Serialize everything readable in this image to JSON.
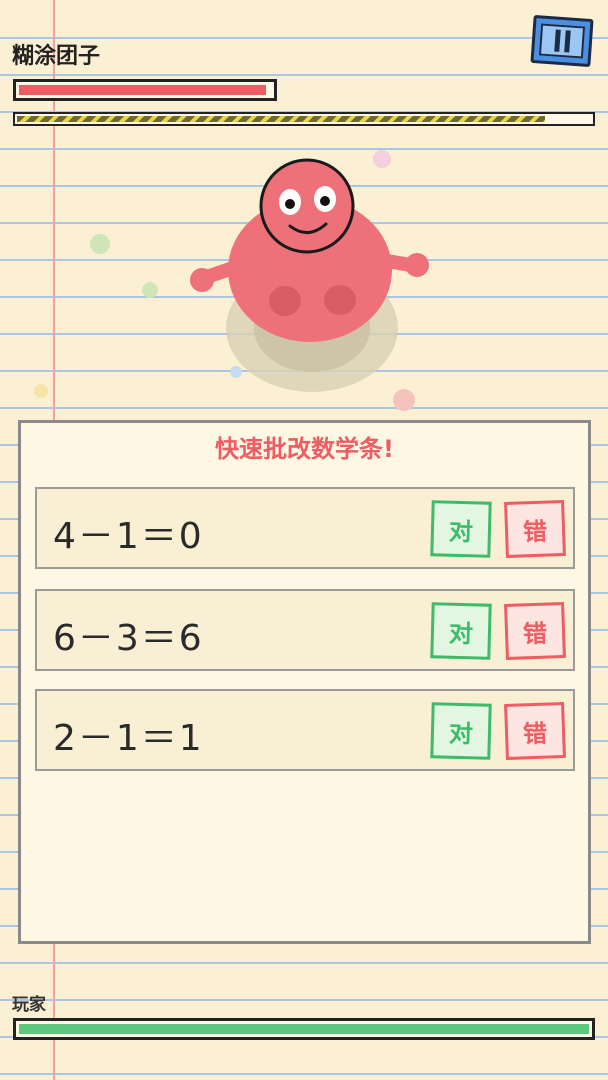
{
  "enemy": {
    "name": "糊涂团子",
    "hp_fraction": 0.98,
    "color": "#ee5d63"
  },
  "timer": {
    "fraction": 0.92
  },
  "pause": {
    "icon": "pause-icon"
  },
  "panel": {
    "title": "快速批改数学条!",
    "rows": [
      {
        "equation": "4－1＝0",
        "ok_label": "对",
        "no_label": "错"
      },
      {
        "equation": "6－3＝6",
        "ok_label": "对",
        "no_label": "错"
      },
      {
        "equation": "2－1＝1",
        "ok_label": "对",
        "no_label": "错"
      }
    ]
  },
  "player": {
    "label": "玩家",
    "hp_fraction": 1.0,
    "color": "#5cc87c"
  },
  "colors": {
    "correct": "#3dbb68",
    "wrong": "#ee5d63",
    "paper": "#fbf0d3"
  }
}
